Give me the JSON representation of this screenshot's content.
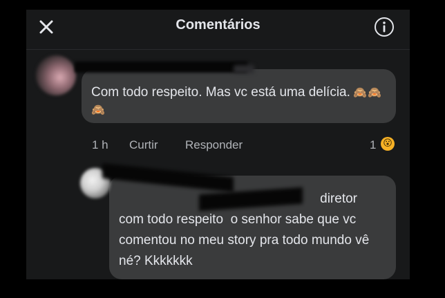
{
  "header": {
    "title": "Comentários",
    "close_icon": "close-icon",
    "info_icon": "info-icon"
  },
  "comment": {
    "text": "Com todo respeito. Mas vc está uma delícia.",
    "emojis": "🙈🙈🙈",
    "time": "1 h",
    "like_label": "Curtir",
    "reply_label": "Responder",
    "reaction_count": "1",
    "reaction_icon": "wow-reaction-icon"
  },
  "reply": {
    "text": "diretor\ncom todo respeito  o senhor sabe que vc comentou no meu story pra todo mundo vê né? Kkkkkkk"
  },
  "colors": {
    "background": "#18191a",
    "bubble": "#3a3b3c",
    "text": "#e4e6eb",
    "secondary_text": "#b0b3b8"
  }
}
